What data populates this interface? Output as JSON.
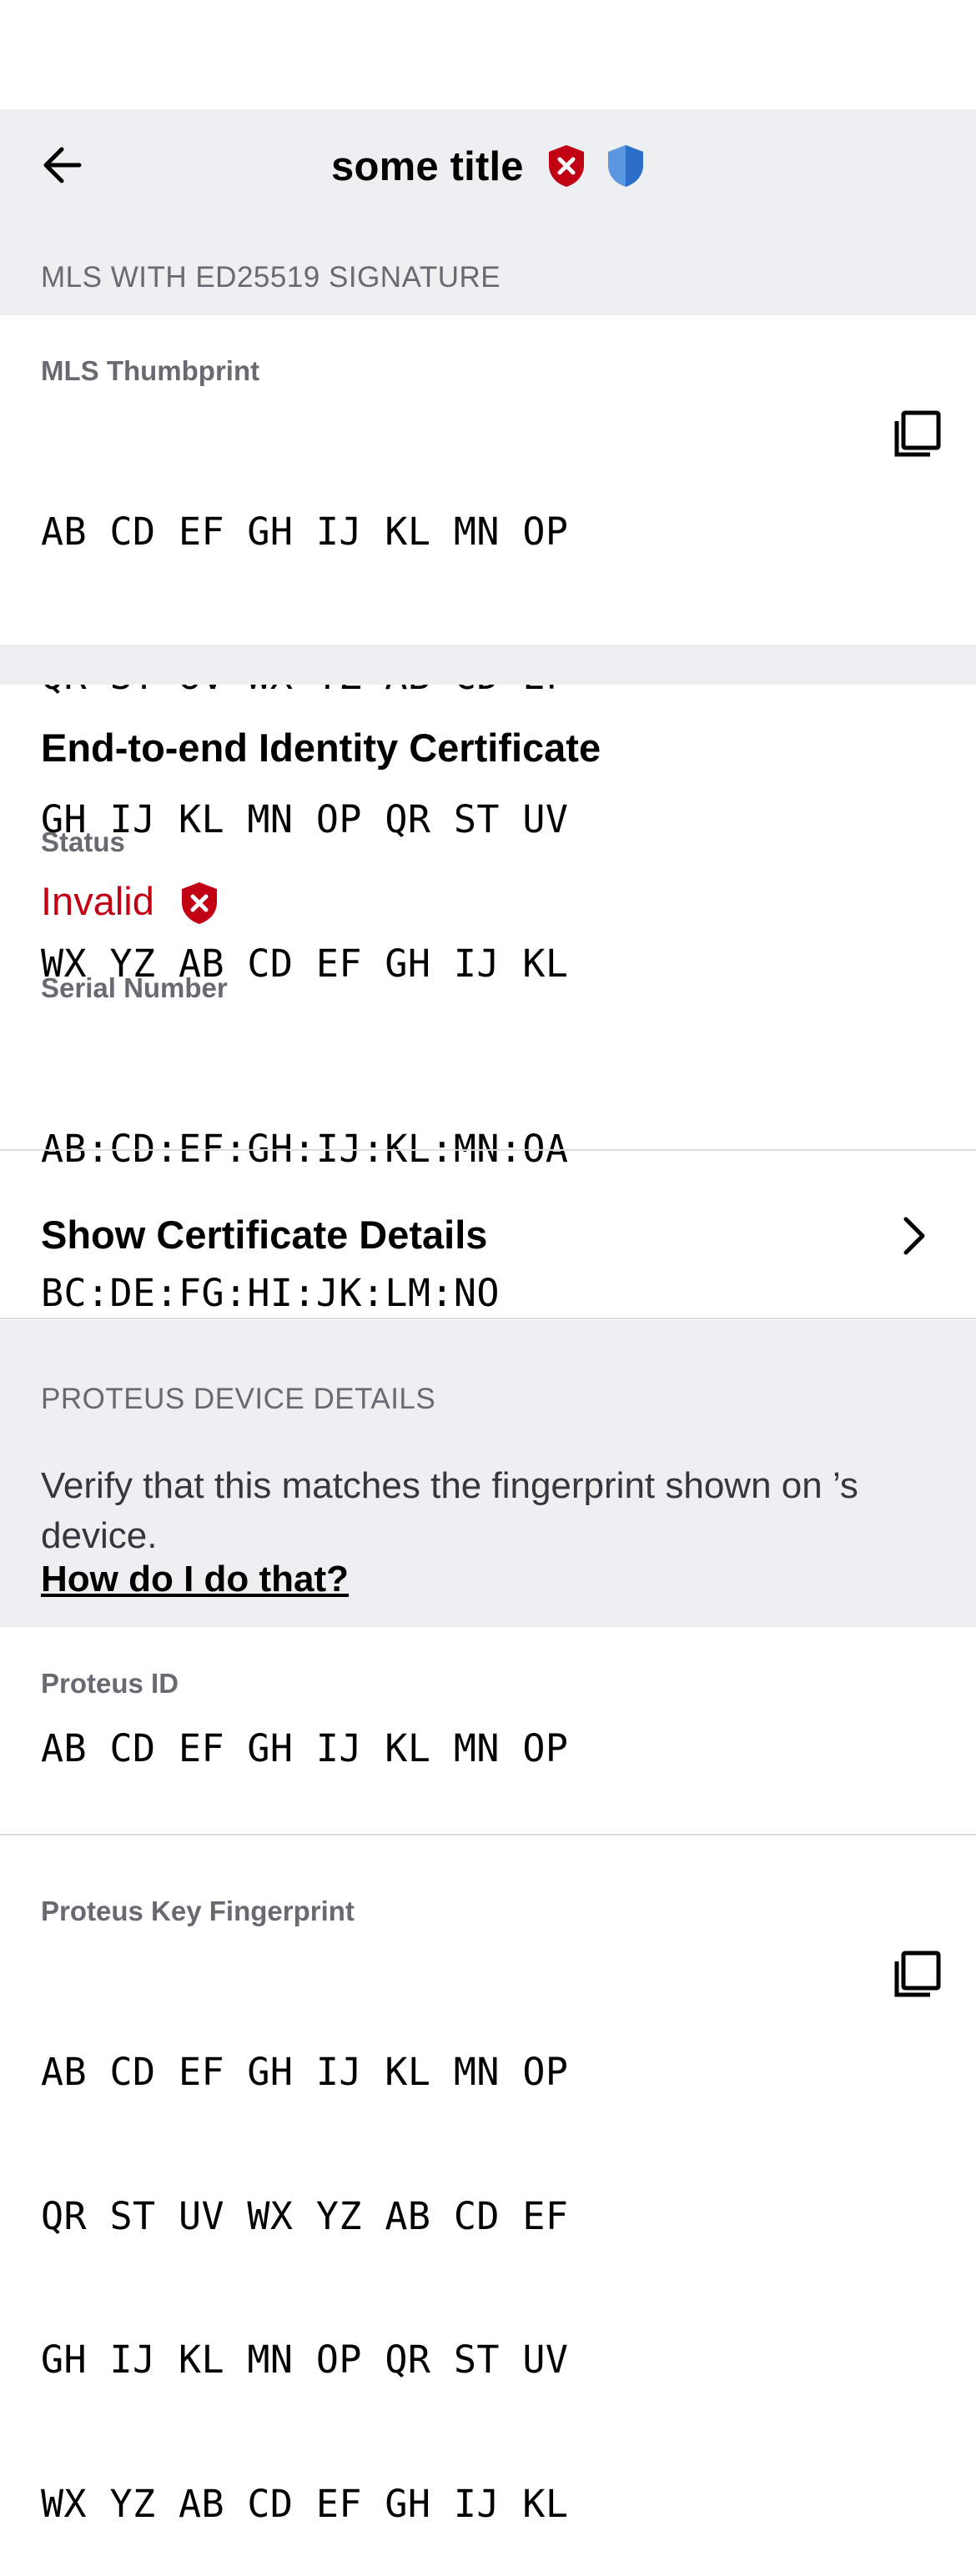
{
  "nav": {
    "title": "some title",
    "back_icon": "arrow-left-icon",
    "status_icons": [
      "shield-x-red-icon",
      "shield-half-blue-icon"
    ]
  },
  "mls": {
    "section_header": "MLS WITH ED25519 SIGNATURE",
    "thumbprint_label": "MLS Thumbprint",
    "thumbprint_lines": [
      "AB CD EF GH IJ KL MN OP",
      "QR ST UV WX YZ AB CD EF",
      "GH IJ KL MN OP QR ST UV",
      "WX YZ AB CD EF GH IJ KL"
    ],
    "copy_icon": "copy-icon"
  },
  "certificate": {
    "title": "End-to-end Identity Certificate",
    "status_label": "Status",
    "status_value": "Invalid",
    "status_icon": "shield-x-red-icon",
    "serial_label": "Serial Number",
    "serial_lines": [
      "AB:CD:EF:GH:IJ:KL:MN:OA",
      "BC:DE:FG:HI:JK:LM:NO"
    ],
    "details_button": "Show Certificate Details",
    "details_icon": "chevron-right-icon"
  },
  "proteus": {
    "section_header": "PROTEUS DEVICE DETAILS",
    "verify_text": "Verify that this matches the fingerprint shown on ’s device.",
    "help_link": "How do I do that?",
    "id_label": "Proteus ID",
    "id_value": "AB CD EF GH IJ KL MN OP",
    "fingerprint_label": "Proteus Key Fingerprint",
    "fingerprint_lines": [
      "AB CD EF GH IJ KL MN OP",
      "QR ST UV WX YZ AB CD EF",
      "GH IJ KL MN OP QR ST UV",
      "WX YZ AB CD EF GH IJ KL"
    ]
  },
  "colors": {
    "section_bg": "#edeff0",
    "label_grey": "#676b71",
    "error_red": "#c20013",
    "shield_blue": "#2b6fca",
    "divider": "#dcdee1"
  }
}
